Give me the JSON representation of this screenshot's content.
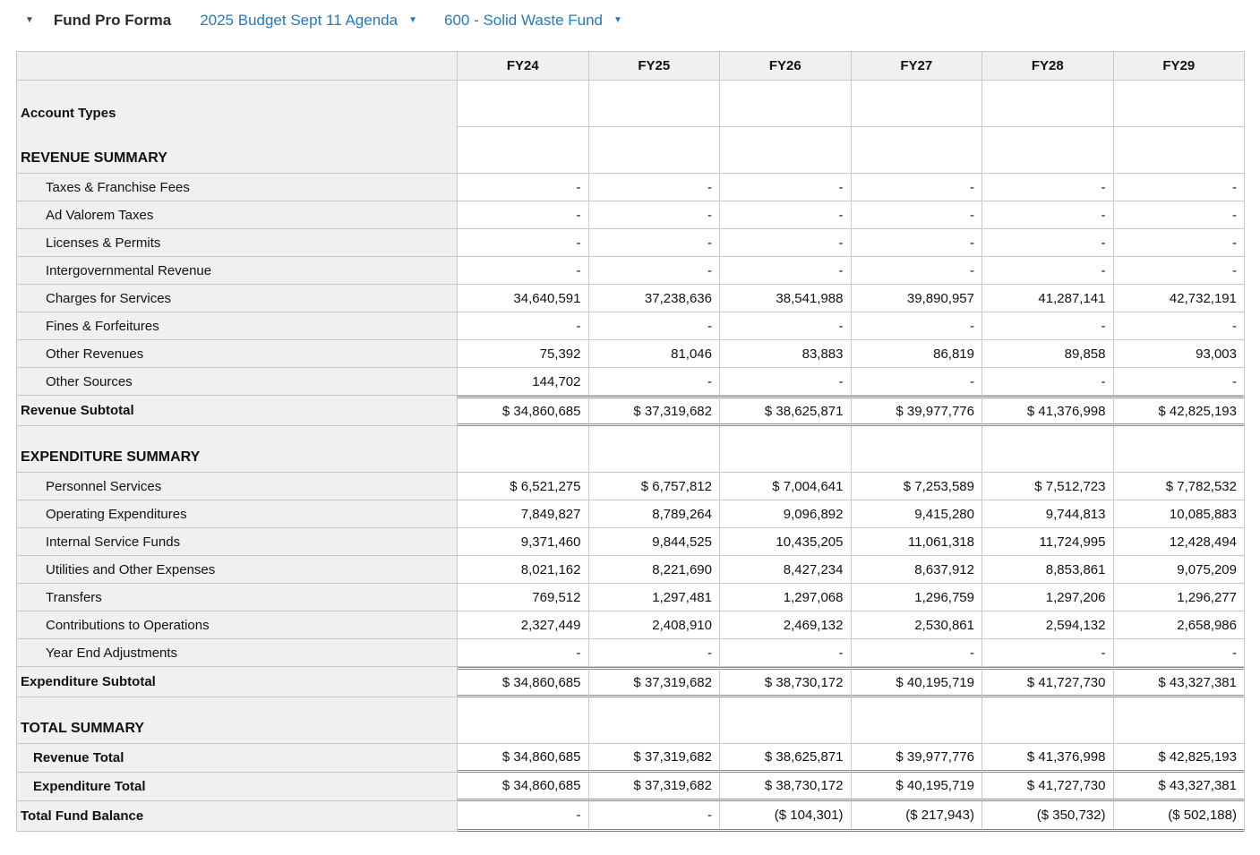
{
  "topbar": {
    "collapse_caret": "▼",
    "title": "Fund Pro Forma",
    "budget_dropdown": "2025 Budget Sept 11 Agenda",
    "fund_dropdown": "600 - Solid Waste Fund",
    "dropdown_caret": "▼"
  },
  "colors": {
    "link_blue": "#2878bc",
    "cell_gray": "#f0f0f0",
    "border_light": "#c8c8c8",
    "border_dark": "#8c8c8c"
  },
  "table": {
    "columns": [
      "FY24",
      "FY25",
      "FY26",
      "FY27",
      "FY28",
      "FY29"
    ],
    "rows": [
      {
        "kind": "band",
        "labels": [
          "Account Types",
          "REVENUE SUMMARY"
        ]
      },
      {
        "kind": "item",
        "level": 2,
        "label": "Taxes & Franchise Fees",
        "values": [
          "-",
          "-",
          "-",
          "-",
          "-",
          "-"
        ]
      },
      {
        "kind": "item",
        "level": 2,
        "label": "Ad Valorem Taxes",
        "values": [
          "-",
          "-",
          "-",
          "-",
          "-",
          "-"
        ]
      },
      {
        "kind": "item",
        "level": 2,
        "label": "Licenses & Permits",
        "values": [
          "-",
          "-",
          "-",
          "-",
          "-",
          "-"
        ]
      },
      {
        "kind": "item",
        "level": 2,
        "label": "Intergovernmental Revenue",
        "values": [
          "-",
          "-",
          "-",
          "-",
          "-",
          "-"
        ]
      },
      {
        "kind": "item",
        "level": 2,
        "label": "Charges for Services",
        "values": [
          "34,640,591",
          "37,238,636",
          "38,541,988",
          "39,890,957",
          "41,287,141",
          "42,732,191"
        ]
      },
      {
        "kind": "item",
        "level": 2,
        "label": "Fines & Forfeitures",
        "values": [
          "-",
          "-",
          "-",
          "-",
          "-",
          "-"
        ]
      },
      {
        "kind": "item",
        "level": 2,
        "label": "Other Revenues",
        "values": [
          "75,392",
          "81,046",
          "83,883",
          "86,819",
          "89,858",
          "93,003"
        ]
      },
      {
        "kind": "item",
        "level": 2,
        "label": "Other Sources",
        "values": [
          "144,702",
          "-",
          "-",
          "-",
          "-",
          "-"
        ]
      },
      {
        "kind": "subtotal",
        "level": 0,
        "label": "Revenue Subtotal",
        "values": [
          "$ 34,860,685",
          "$ 37,319,682",
          "$ 38,625,871",
          "$ 39,977,776",
          "$ 41,376,998",
          "$ 42,825,193"
        ]
      },
      {
        "kind": "band",
        "labels": [
          "EXPENDITURE SUMMARY"
        ]
      },
      {
        "kind": "item",
        "level": 2,
        "label": "Personnel Services",
        "values": [
          "$ 6,521,275",
          "$ 6,757,812",
          "$ 7,004,641",
          "$ 7,253,589",
          "$ 7,512,723",
          "$ 7,782,532"
        ]
      },
      {
        "kind": "item",
        "level": 2,
        "label": "Operating Expenditures",
        "values": [
          "7,849,827",
          "8,789,264",
          "9,096,892",
          "9,415,280",
          "9,744,813",
          "10,085,883"
        ]
      },
      {
        "kind": "item",
        "level": 2,
        "label": "Internal Service Funds",
        "values": [
          "9,371,460",
          "9,844,525",
          "10,435,205",
          "11,061,318",
          "11,724,995",
          "12,428,494"
        ]
      },
      {
        "kind": "item",
        "level": 2,
        "label": "Utilities and Other Expenses",
        "values": [
          "8,021,162",
          "8,221,690",
          "8,427,234",
          "8,637,912",
          "8,853,861",
          "9,075,209"
        ]
      },
      {
        "kind": "item",
        "level": 2,
        "label": "Transfers",
        "values": [
          "769,512",
          "1,297,481",
          "1,297,068",
          "1,296,759",
          "1,297,206",
          "1,296,277"
        ]
      },
      {
        "kind": "item",
        "level": 2,
        "label": "Contributions to Operations",
        "values": [
          "2,327,449",
          "2,408,910",
          "2,469,132",
          "2,530,861",
          "2,594,132",
          "2,658,986"
        ]
      },
      {
        "kind": "item",
        "level": 2,
        "label": "Year End Adjustments",
        "values": [
          "-",
          "-",
          "-",
          "-",
          "-",
          "-"
        ]
      },
      {
        "kind": "subtotal",
        "level": 0,
        "label": "Expenditure Subtotal",
        "values": [
          "$ 34,860,685",
          "$ 37,319,682",
          "$ 38,730,172",
          "$ 40,195,719",
          "$ 41,727,730",
          "$ 43,327,381"
        ]
      },
      {
        "kind": "band",
        "labels": [
          "TOTAL SUMMARY"
        ]
      },
      {
        "kind": "total",
        "level": 1,
        "label": "Revenue Total",
        "values": [
          "$ 34,860,685",
          "$ 37,319,682",
          "$ 38,625,871",
          "$ 39,977,776",
          "$ 41,376,998",
          "$ 42,825,193"
        ]
      },
      {
        "kind": "total",
        "level": 1,
        "label": "Expenditure Total",
        "values": [
          "$ 34,860,685",
          "$ 37,319,682",
          "$ 38,730,172",
          "$ 40,195,719",
          "$ 41,727,730",
          "$ 43,327,381"
        ]
      },
      {
        "kind": "balance",
        "level": 0,
        "label": "Total Fund Balance",
        "values": [
          "-",
          "-",
          "($ 104,301)",
          "($ 217,943)",
          "($ 350,732)",
          "($ 502,188)"
        ]
      }
    ]
  }
}
